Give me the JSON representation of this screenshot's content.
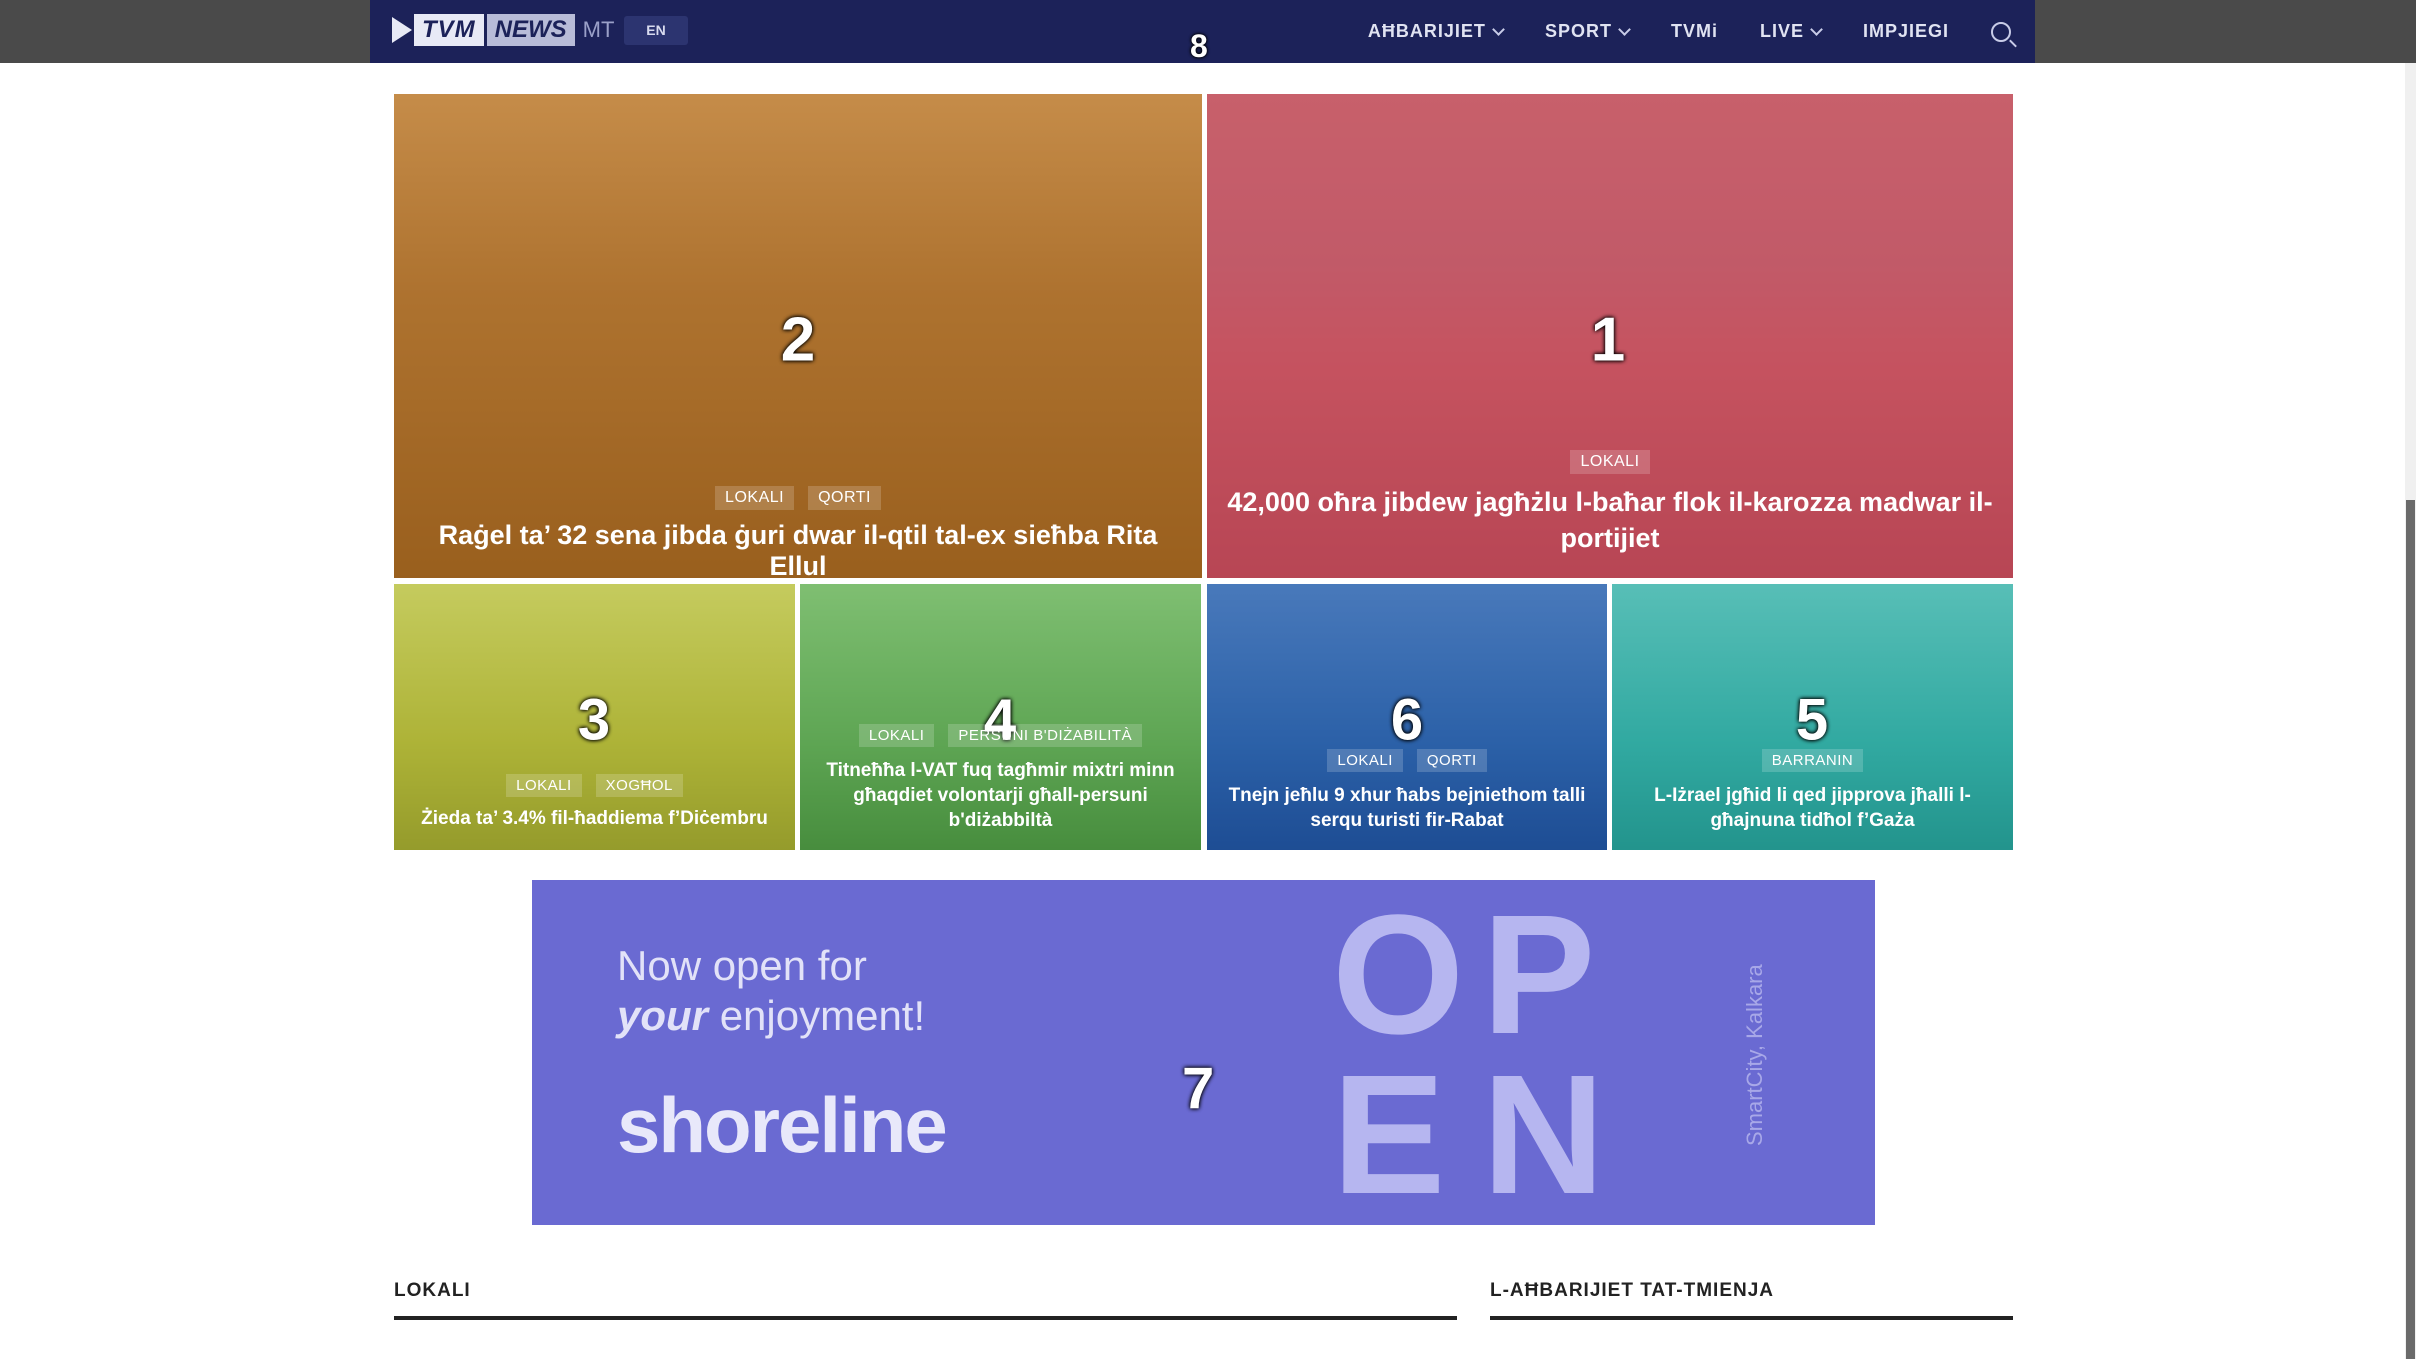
{
  "header": {
    "logo_tvm": "TVM",
    "logo_news": "NEWS",
    "logo_mt": "MT",
    "lang_label": "EN",
    "nav": [
      "AĦBARIJIET",
      "SPORT",
      "TVMi",
      "LIVE",
      "IMPJIEGI"
    ],
    "overlay_number": "8"
  },
  "tiles": {
    "t1": {
      "number": "1",
      "categories": [
        "LOKALI"
      ],
      "title": "42,000 oħra jibdew jagħżlu l-baħar flok il-karozza madwar il-portijiet"
    },
    "t2": {
      "number": "2",
      "categories": [
        "LOKALI",
        "QORTI"
      ],
      "title": "Raġel ta’ 32 sena jibda ġuri dwar il-qtil tal-ex sieħba Rita Ellul"
    },
    "t3": {
      "number": "3",
      "categories": [
        "LOKALI",
        "XOGĦOL"
      ],
      "title": "Żieda ta’ 3.4% fil-ħaddiema f’Diċembru"
    },
    "t4": {
      "number": "4",
      "categories": [
        "LOKALI",
        "PERSUNI B'DIŻABILITÀ"
      ],
      "title": "Titneħħa l-VAT fuq tagħmir mixtri minn għaqdiet volontarji għall-persuni b'diżabbiltà"
    },
    "t5": {
      "number": "5",
      "categories": [
        "BARRANIN"
      ],
      "title": "L-Iżrael jgħid li qed jipprova jħalli l-għajnuna tidħol f’Gaża"
    },
    "t6": {
      "number": "6",
      "categories": [
        "LOKALI",
        "QORTI"
      ],
      "title": "Tnejn jeħlu 9 xhur ħabs bejniethom talli serqu turisti fir-Rabat"
    }
  },
  "ad": {
    "number": "7",
    "tagline_1": "Now open for",
    "tagline_em": "your",
    "tagline_2": "enjoyment!",
    "brand": "shoreline",
    "open_letters": [
      "O",
      "P",
      "E",
      "N"
    ],
    "location": "SmartCity, Kalkara"
  },
  "sections": {
    "left": "LOKALI",
    "right": "L-AĦBARIJIET TAT-TMIENJA"
  }
}
